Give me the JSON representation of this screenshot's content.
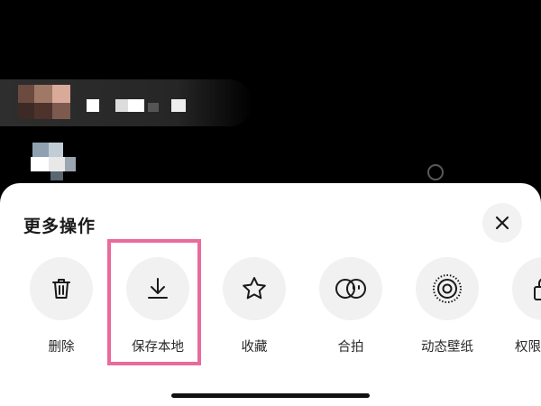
{
  "sheet": {
    "title": "更多操作",
    "close_icon": "close-icon",
    "actions": [
      {
        "label": "删除",
        "icon": "trash-icon"
      },
      {
        "label": "保存本地",
        "icon": "download-icon",
        "highlighted": true
      },
      {
        "label": "收藏",
        "icon": "star-icon"
      },
      {
        "label": "合拍",
        "icon": "duet-icon"
      },
      {
        "label": "动态壁纸",
        "icon": "live-wallpaper-icon"
      },
      {
        "label": "权限",
        "icon": "lock-icon"
      }
    ]
  },
  "colors": {
    "highlight_border": "#ea6a9c",
    "sheet_background": "#ffffff",
    "icon_circle": "#f1f1f1",
    "background": "#000000"
  }
}
